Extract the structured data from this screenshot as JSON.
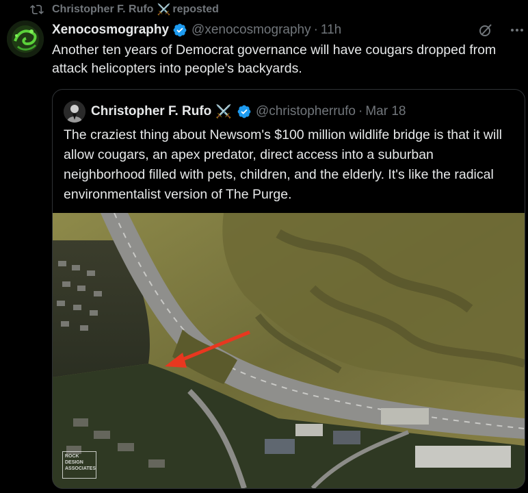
{
  "repost": {
    "name": "Christopher F. Rufo",
    "emoji": "⚔️",
    "label": "reposted",
    "icon": "repost-icon"
  },
  "tweet": {
    "display_name": "Xenocosmography",
    "handle": "@xenocosmography",
    "separator": "·",
    "time": "11h",
    "text": "Another ten years of Democrat governance will have cougars dropped from attack helicopters into people's backyards.",
    "verified_icon": "verified-badge-icon",
    "actions": [
      "grok-icon",
      "more-icon"
    ]
  },
  "quote": {
    "display_name": "Christopher F. Rufo",
    "emoji": "⚔️",
    "handle": "@christopherrufo",
    "separator": "·",
    "time": "Mar 18",
    "text": "The craziest thing about Newsom's $100 million wildlife bridge is that it will allow cougars, an apex predator, direct access into a suburban neighborhood filled with pets, children, and the elderly. It's like the radical environmentalist version of The Purge.",
    "image": {
      "watermark": "ROCK DESIGN ASSOCIATES"
    }
  },
  "colors": {
    "background": "#000000",
    "text": "#e7e9ea",
    "muted": "#71767b",
    "verified": "#1d9bf0",
    "border": "#2f3336",
    "arrow": "#e8371f"
  }
}
